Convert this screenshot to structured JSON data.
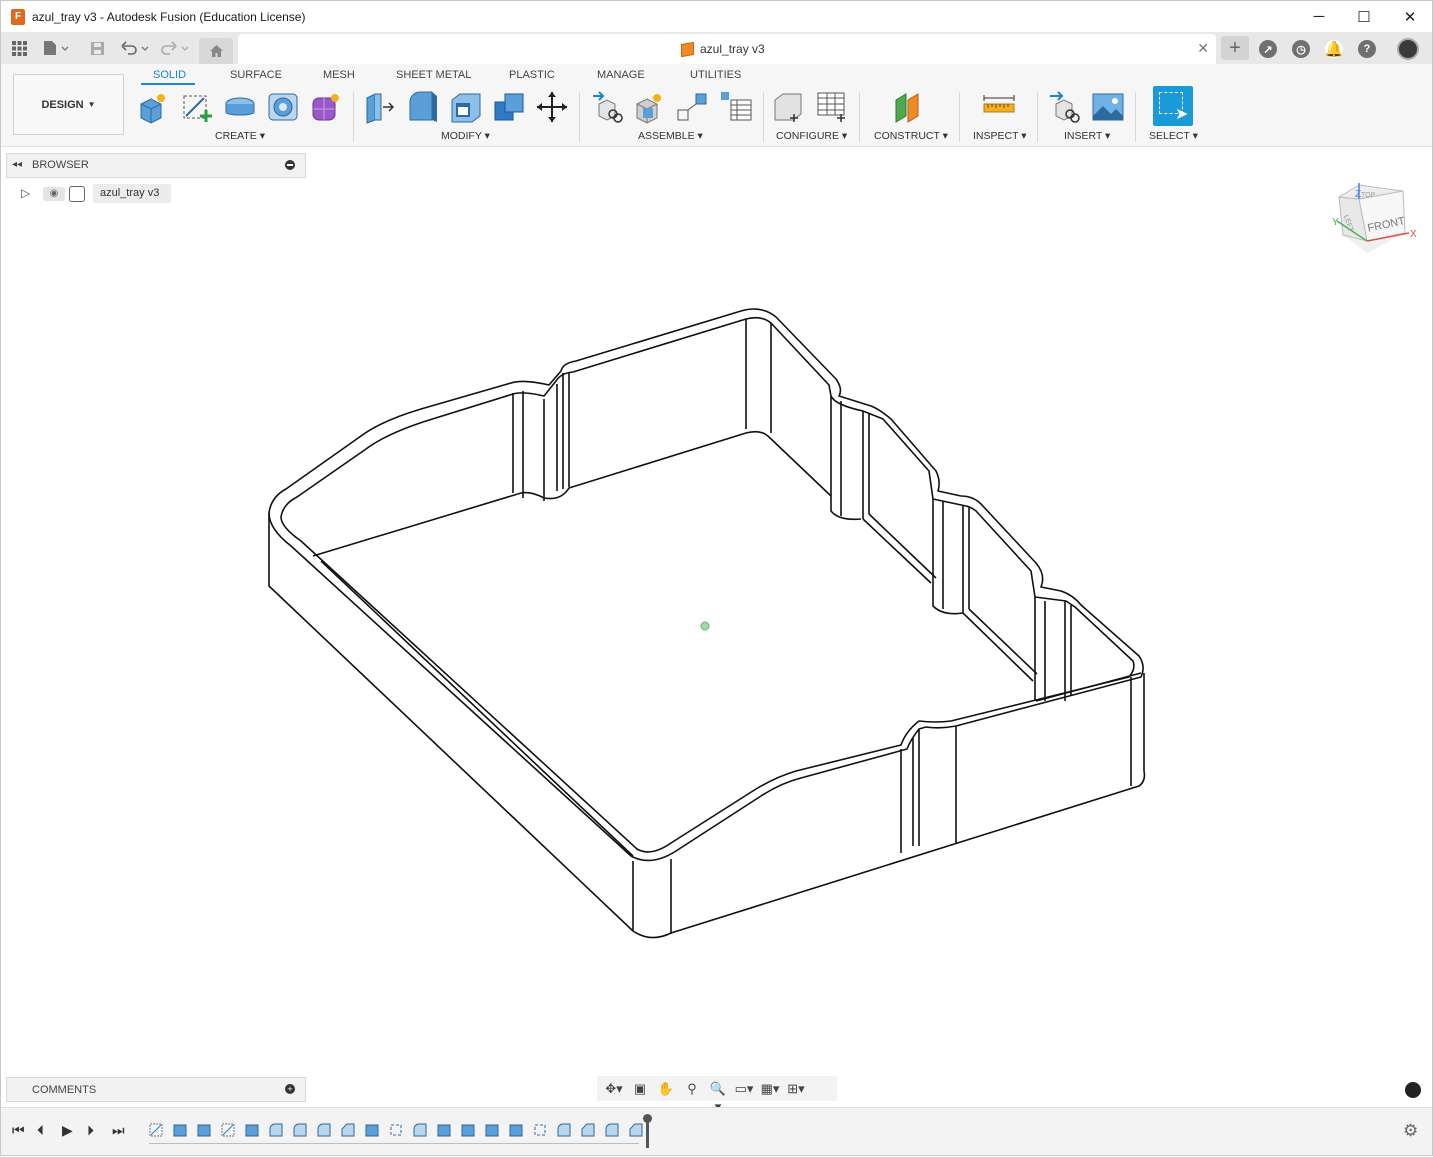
{
  "window": {
    "title": "azul_tray v3 - Autodesk Fusion (Education License)",
    "logo_letter": "F",
    "minimize": "─",
    "maximize": "☐",
    "close": "✕"
  },
  "tabbar": {
    "document_tab": "azul_tray v3",
    "close_glyph": "✕",
    "new_tab_glyph": "+"
  },
  "ribbon": {
    "workspace": "DESIGN",
    "tabs": [
      "SOLID",
      "SURFACE",
      "MESH",
      "SHEET METAL",
      "PLASTIC",
      "MANAGE",
      "UTILITIES"
    ],
    "active_tab": "SOLID",
    "groups": [
      "CREATE",
      "MODIFY",
      "ASSEMBLE",
      "CONFIGURE",
      "CONSTRUCT",
      "INSPECT",
      "INSERT",
      "SELECT"
    ]
  },
  "browser": {
    "title": "BROWSER",
    "root_item": "azul_tray v3"
  },
  "viewcube": {
    "front": "FRONT",
    "top": "TOP",
    "left": "LEFT",
    "axis_x": "X",
    "axis_y": "Y",
    "axis_z": "Z"
  },
  "comments": {
    "title": "COMMENTS"
  },
  "colors": {
    "accent": "#1a84d6",
    "select_tool": "#1a9ad6",
    "model_edges": "#111111"
  }
}
